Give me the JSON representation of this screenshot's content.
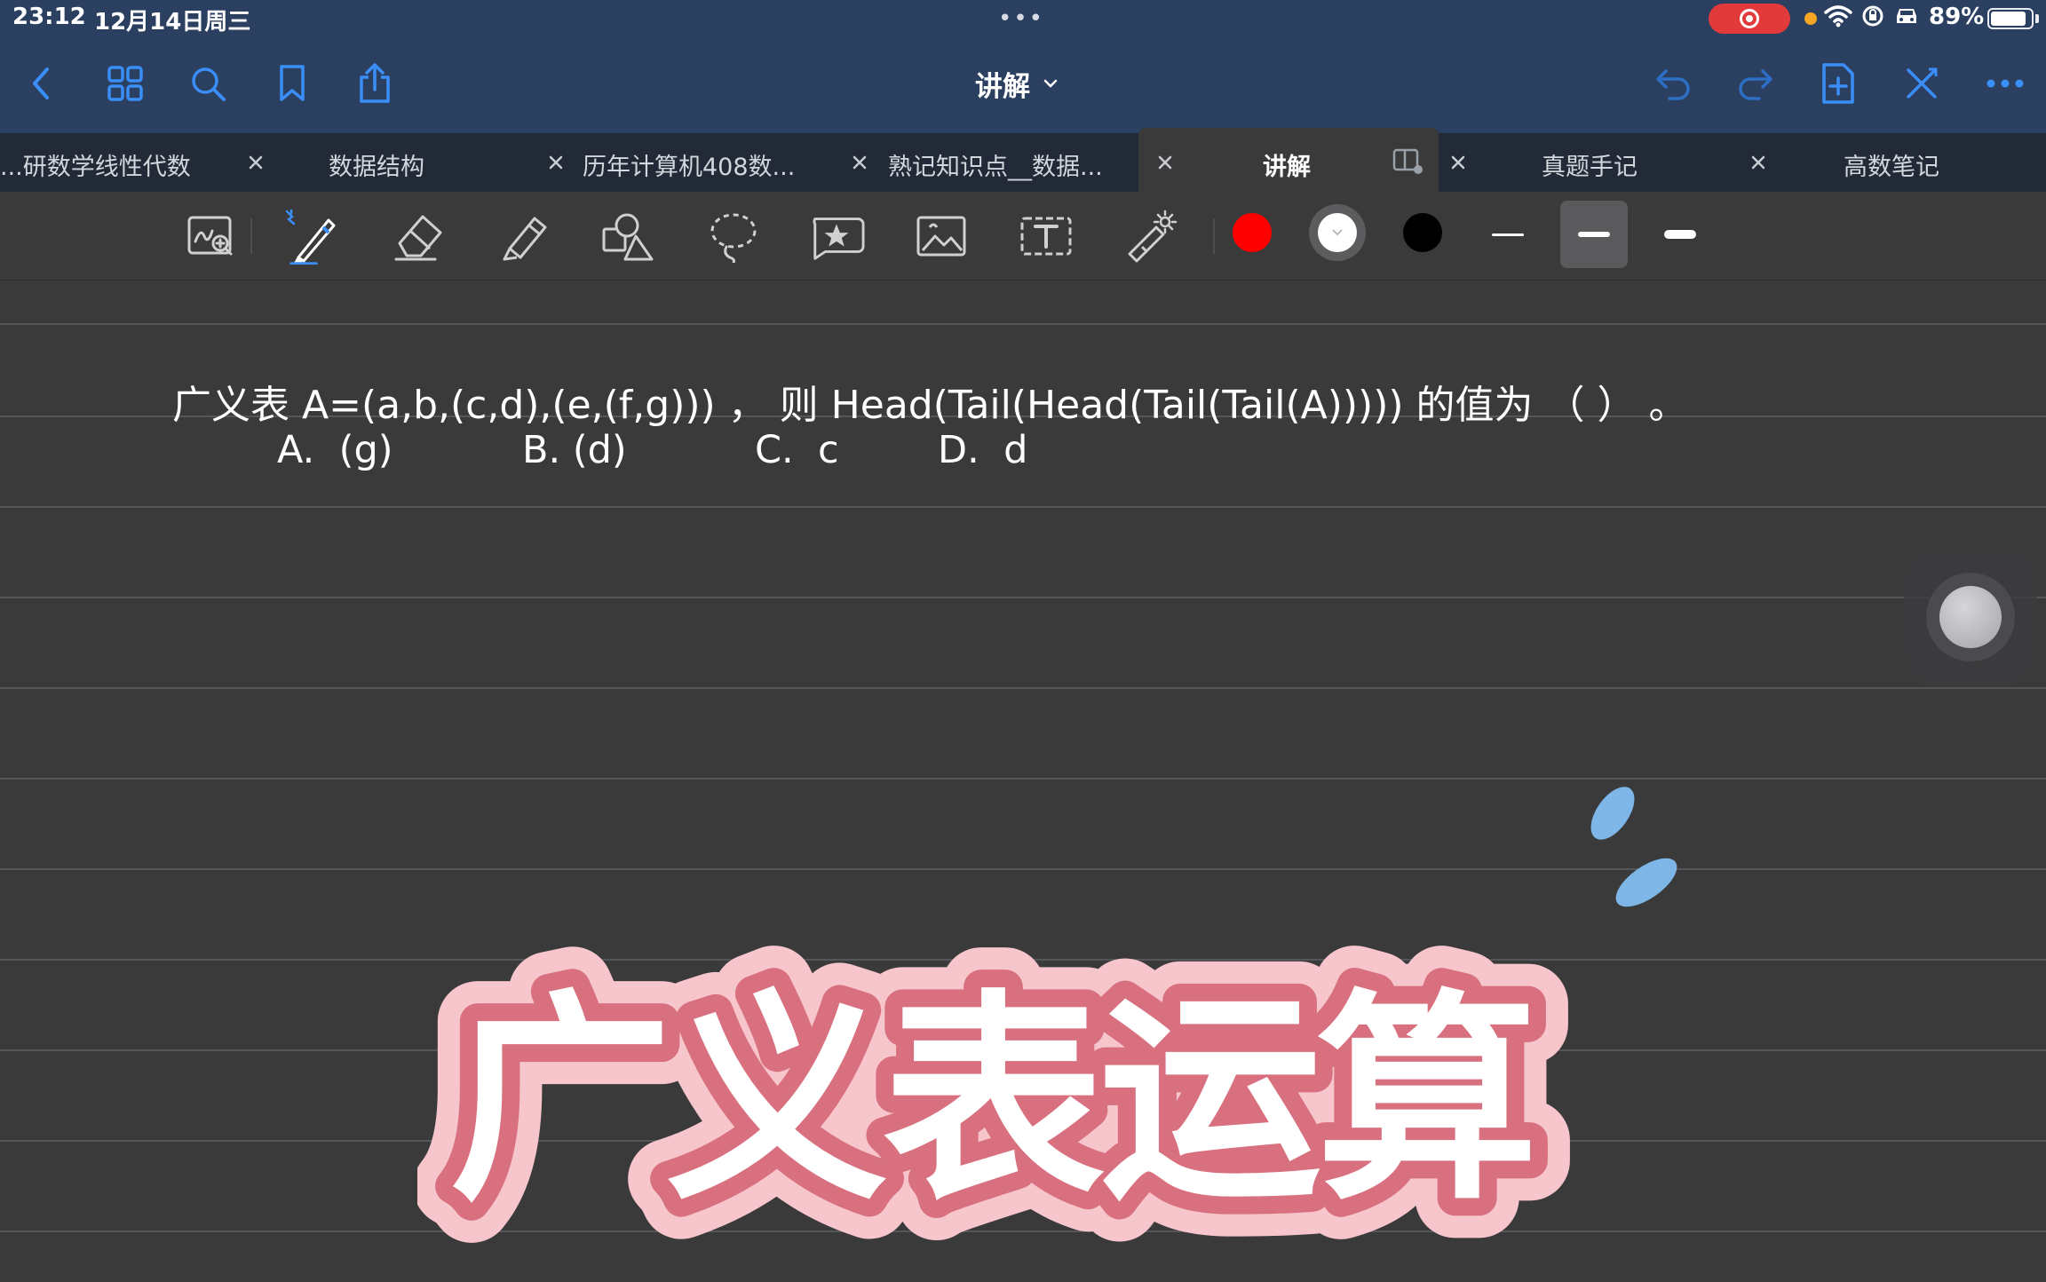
{
  "status_bar": {
    "time": "23:12",
    "date": "12月14日周三",
    "multitask": "•••",
    "battery_percent": "89%",
    "battery_level": 0.89,
    "recording": true
  },
  "nav": {
    "doc_title": "讲解",
    "left_icons": [
      "back-icon",
      "grid-icon",
      "search-icon",
      "bookmark-icon",
      "share-icon"
    ],
    "right_icons": [
      "undo-icon",
      "redo-icon",
      "add-page-icon",
      "close-edit-icon",
      "more-icon"
    ]
  },
  "tabs": [
    {
      "label": "研数学线性代数...",
      "active": false
    },
    {
      "label": "数据结构",
      "active": false
    },
    {
      "label": "历年计算机408数...",
      "active": false
    },
    {
      "label": "熟记知识点__数据...",
      "active": false
    },
    {
      "label": "讲解",
      "active": true
    },
    {
      "label": "真题手记",
      "active": false
    },
    {
      "label": "高数笔记",
      "active": false
    }
  ],
  "toolbar": {
    "tools": [
      "zoom-window-icon",
      "pen-icon",
      "eraser-icon",
      "highlighter-icon",
      "shapes-icon",
      "lasso-icon",
      "sticker-icon",
      "image-icon",
      "text-icon",
      "laser-pointer-icon"
    ],
    "colors": [
      "#ff0000",
      "#ffffff",
      "#000000"
    ],
    "selected_color": "#ffffff",
    "stroke_widths": [
      "thin",
      "medium",
      "thick"
    ],
    "selected_stroke": "medium"
  },
  "note": {
    "question": "广义表 A=(a,b,(c,d),(e,(f,g))) ， 则 Head(Tail(Head(Tail(Tail(A))))) 的值为 （ ） 。",
    "options": [
      {
        "letter": "A.",
        "text": "(g)"
      },
      {
        "letter": "B.",
        "text": "(d)"
      },
      {
        "letter": "C.",
        "text": "c"
      },
      {
        "letter": "D.",
        "text": "d"
      }
    ],
    "sticker_text": "广义表运算",
    "sticker_colors": {
      "fill": "#ffffff",
      "outline": "#d9707f",
      "halo": "#f7c6cc",
      "accent": "#7fb6e8"
    }
  }
}
